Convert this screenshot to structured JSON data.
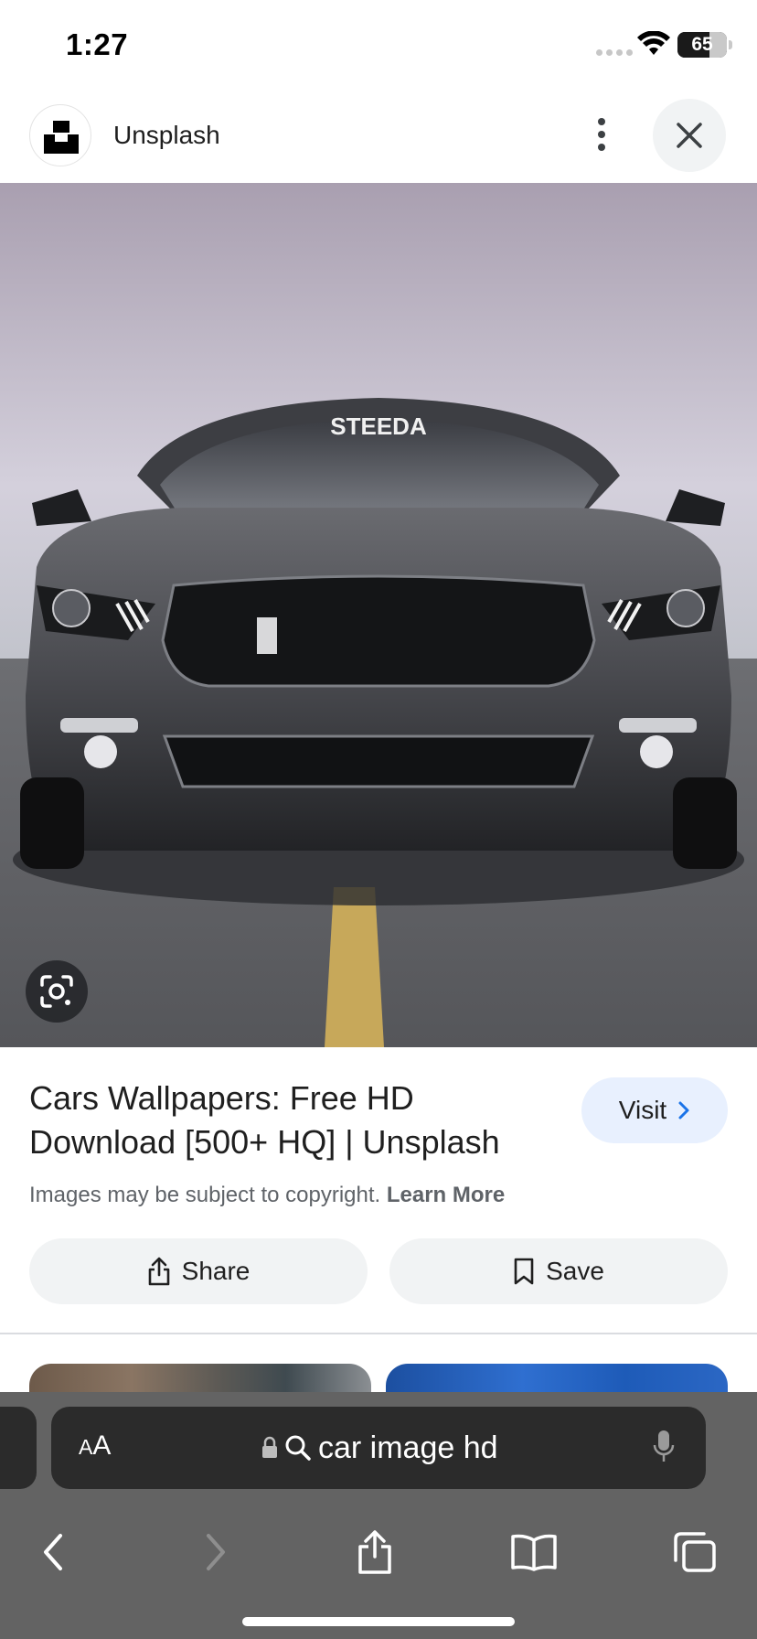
{
  "status_bar": {
    "time": "1:27",
    "battery_level": "65",
    "battery_fraction": 0.65
  },
  "header": {
    "site_name": "Unsplash",
    "logo_icon": "unsplash-logo",
    "more_icon": "more-vert-icon",
    "close_icon": "close-icon"
  },
  "image": {
    "windshield_text": "STEEDA",
    "lens_icon": "google-lens-icon"
  },
  "result": {
    "title": "Cars Wallpapers: Free HD Download [500+ HQ] | Unsplash",
    "visit_label": "Visit",
    "copyright_text": "Images may be subject to copyright.",
    "learn_more_label": "Learn More",
    "share_label": "Share",
    "save_label": "Save"
  },
  "safari": {
    "text_size_label_small": "A",
    "text_size_label_large": "A",
    "search_query": "car image hd",
    "icons": [
      "back-icon",
      "forward-icon",
      "share-icon",
      "bookmarks-icon",
      "tabs-icon",
      "microphone-icon",
      "lock-icon",
      "search-icon"
    ]
  },
  "colors": {
    "visit_bg": "#e8f0fe",
    "pill_bg": "#f1f3f4",
    "safari_bar": "#636363",
    "address_bg": "#2b2b2b"
  }
}
